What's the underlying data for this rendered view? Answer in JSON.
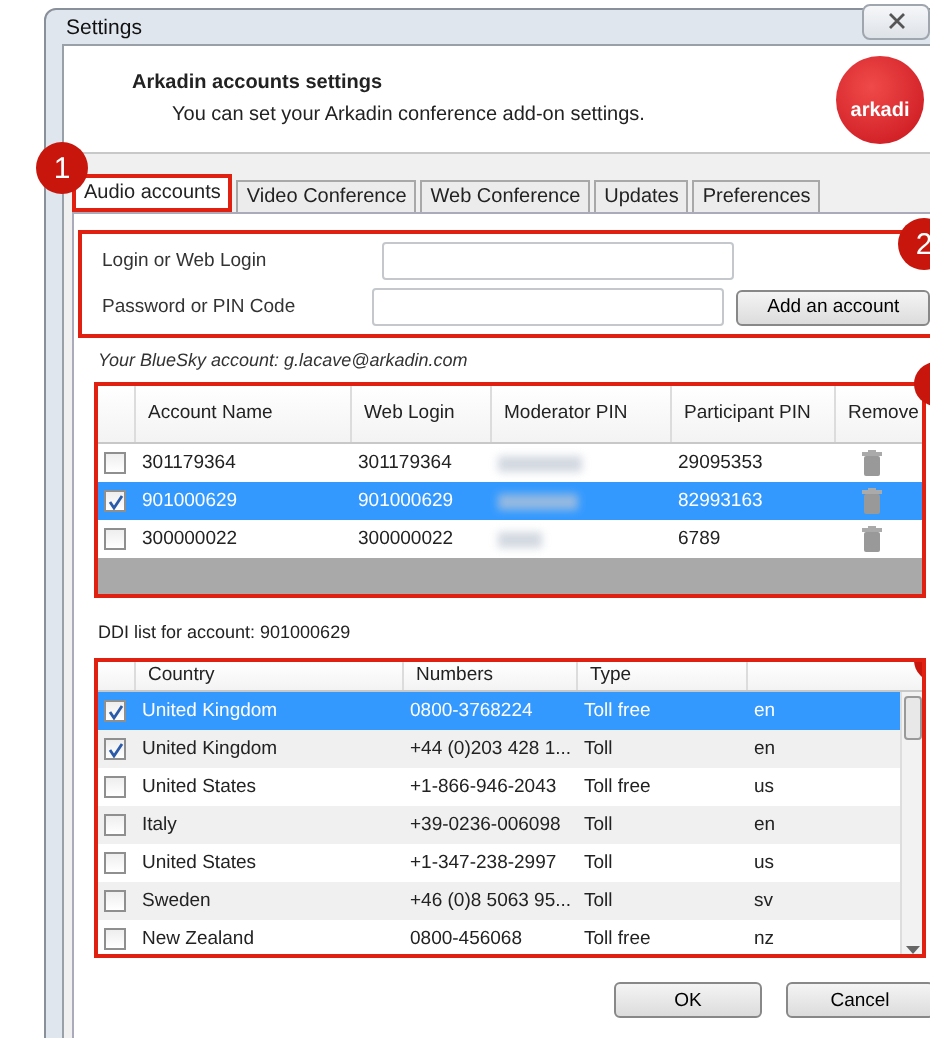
{
  "window": {
    "title": "Settings"
  },
  "header": {
    "title": "Arkadin accounts settings",
    "subtitle": "You can set your Arkadin conference add-on settings.",
    "logo_text": "arkadi"
  },
  "tabs": [
    {
      "label": "Audio accounts",
      "selected": true
    },
    {
      "label": "Video Conference",
      "selected": false
    },
    {
      "label": "Web Conference",
      "selected": false
    },
    {
      "label": "Updates",
      "selected": false
    },
    {
      "label": "Preferences",
      "selected": false
    }
  ],
  "callouts": [
    {
      "label": "1"
    },
    {
      "label": "2"
    }
  ],
  "login_form": {
    "fields": [
      {
        "label": "Login or Web Login"
      },
      {
        "label": "Password or PIN Code"
      }
    ],
    "add_button": "Add an account"
  },
  "bluesky_account": "Your BlueSky account: g.lacave@arkadin.com",
  "accounts": {
    "columns": [
      "Account Name",
      "Web Login",
      "Moderator PIN",
      "Participant PIN",
      "Remove"
    ],
    "rows": [
      {
        "checked": false,
        "selected": false,
        "account_name": "301179364",
        "web_login": "301179364",
        "participant_pin": "29095353"
      },
      {
        "checked": true,
        "selected": true,
        "account_name": "901000629",
        "web_login": "901000629",
        "participant_pin": "82993163"
      },
      {
        "checked": false,
        "selected": false,
        "account_name": "300000022",
        "web_login": "300000022",
        "participant_pin": "6789"
      }
    ]
  },
  "ddi_label": "DDI list for account: 901000629",
  "ddi": {
    "columns": [
      "Country",
      "Numbers",
      "Type"
    ],
    "rows": [
      {
        "checked": true,
        "selected": true,
        "country": "United Kingdom",
        "number": "0800-3768224",
        "type": "Toll free",
        "language": "en"
      },
      {
        "checked": true,
        "selected": false,
        "country": "United Kingdom",
        "number": "+44 (0)203 428 1...",
        "type": "Toll",
        "language": "en"
      },
      {
        "checked": false,
        "selected": false,
        "country": "United States",
        "number": "+1-866-946-2043",
        "type": "Toll free",
        "language": "us"
      },
      {
        "checked": false,
        "selected": false,
        "country": "Italy",
        "number": "+39-0236-006098",
        "type": "Toll",
        "language": "en"
      },
      {
        "checked": false,
        "selected": false,
        "country": "United States",
        "number": "+1-347-238-2997",
        "type": "Toll",
        "language": "us"
      },
      {
        "checked": false,
        "selected": false,
        "country": "Sweden",
        "number": "+46 (0)8 5063 95...",
        "type": "Toll",
        "language": "sv"
      },
      {
        "checked": false,
        "selected": false,
        "country": "New Zealand",
        "number": "0800-456068",
        "type": "Toll free",
        "language": "nz"
      }
    ]
  },
  "buttons": [
    "OK",
    "Cancel"
  ]
}
